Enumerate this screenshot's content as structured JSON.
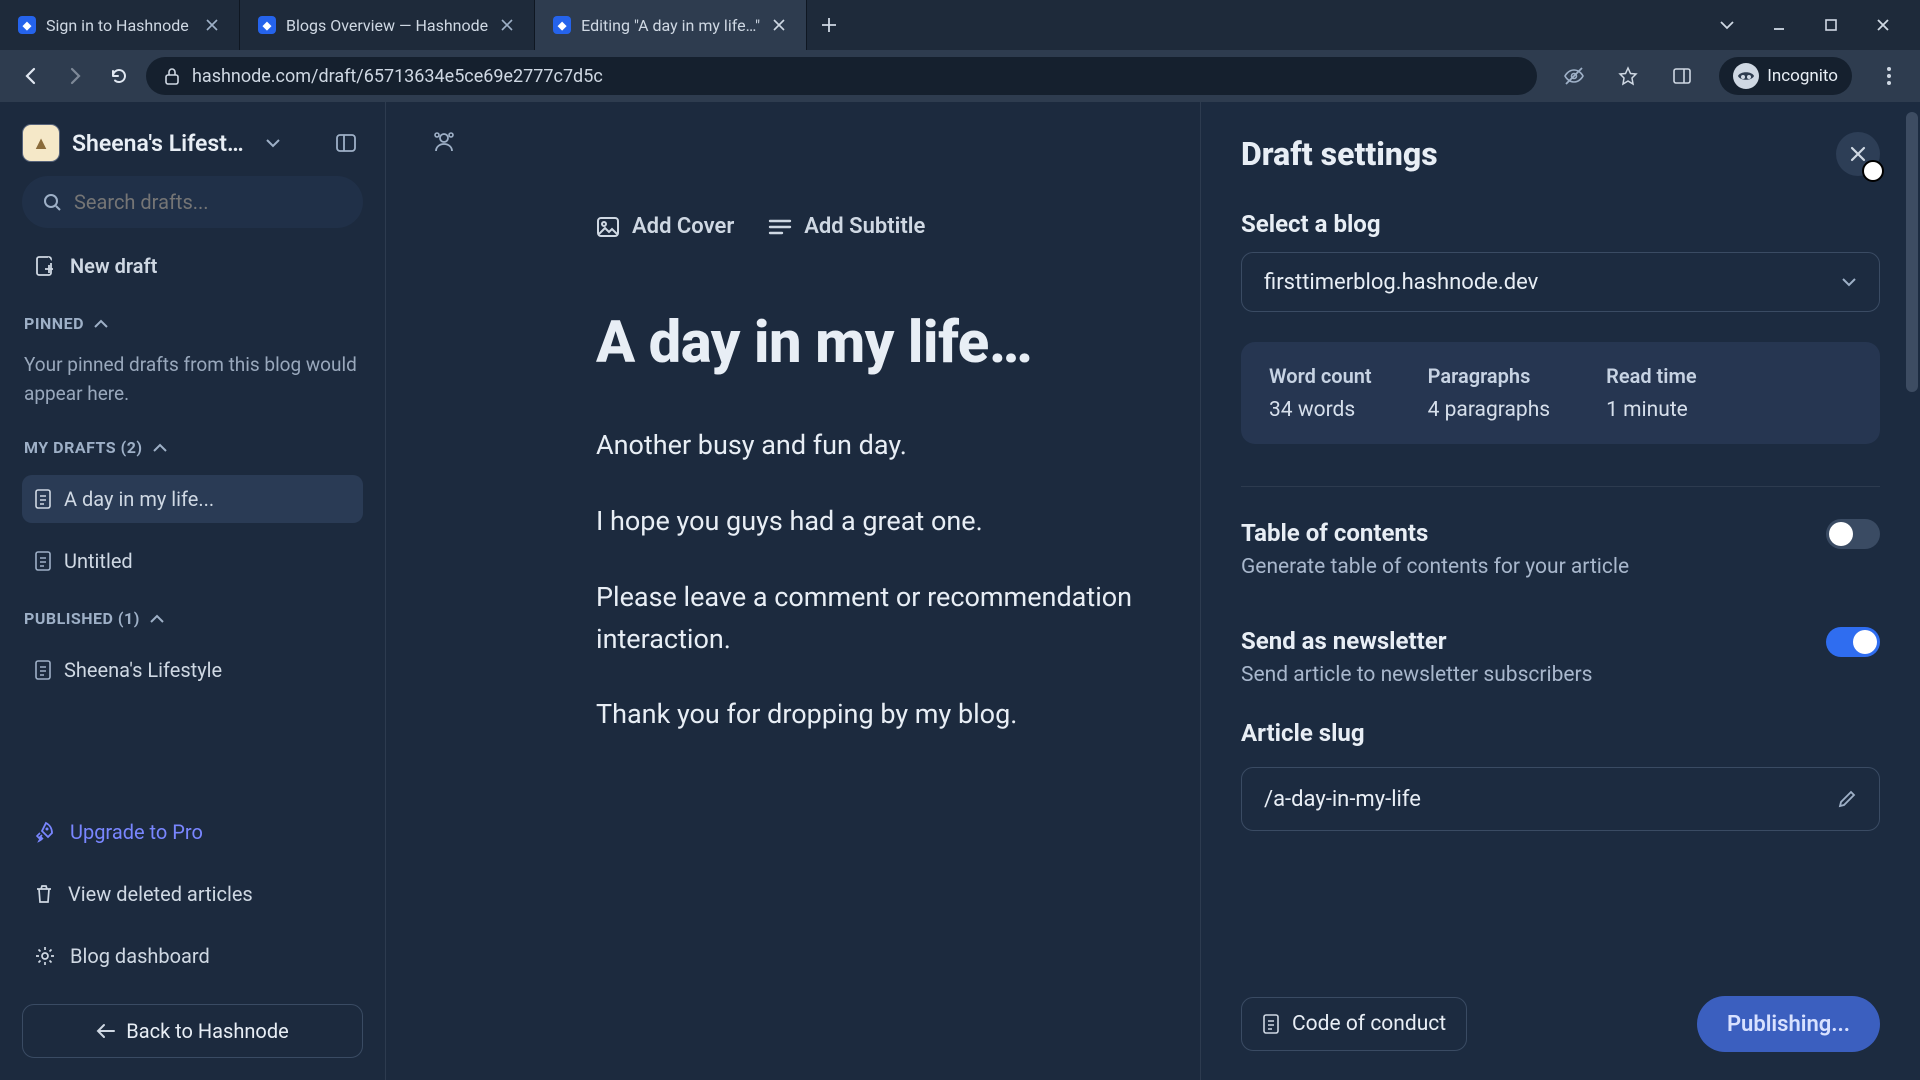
{
  "chrome": {
    "tabs": [
      {
        "title": "Sign in to Hashnode"
      },
      {
        "title": "Blogs Overview — Hashnode"
      },
      {
        "title": "Editing \"A day in my life…\""
      }
    ],
    "url": "hashnode.com/draft/65713634e5ce69e2777c7d5c",
    "incognito": "Incognito"
  },
  "sidebar": {
    "blog_name": "Sheena's Lifest…",
    "search_placeholder": "Search drafts...",
    "new_draft": "New draft",
    "pinned_header": "PINNED",
    "pinned_hint": "Your pinned drafts from this blog would appear here.",
    "drafts_header": "MY DRAFTS (2)",
    "drafts": [
      {
        "title": "A day in my life..."
      },
      {
        "title": "Untitled"
      }
    ],
    "published_header": "PUBLISHED (1)",
    "published": [
      {
        "title": "Sheena's Lifestyle"
      }
    ],
    "upgrade": "Upgrade to Pro",
    "deleted": "View deleted articles",
    "dashboard": "Blog dashboard",
    "back": "Back to Hashnode"
  },
  "editor": {
    "add_cover": "Add Cover",
    "add_subtitle": "Add Subtitle",
    "title": "A day in my life…",
    "paras": [
      "Another busy and fun day.",
      "I hope you guys had a great one.",
      "Please leave a comment or recommendation interaction.",
      "Thank you for dropping by my blog."
    ]
  },
  "panel": {
    "heading": "Draft settings",
    "select_blog_label": "Select a blog",
    "selected_blog": "firsttimerblog.hashnode.dev",
    "stats": {
      "word_label": "Word count",
      "word_val": "34 words",
      "para_label": "Paragraphs",
      "para_val": "4 paragraphs",
      "time_label": "Read time",
      "time_val": "1 minute"
    },
    "toc_title": "Table of contents",
    "toc_desc": "Generate table of contents for your article",
    "newsletter_title": "Send as newsletter",
    "newsletter_desc": "Send article to newsletter subscribers",
    "slug_title": "Article slug",
    "slug_value": "/a-day-in-my-life",
    "coc": "Code of conduct",
    "publish": "Publishing..."
  }
}
